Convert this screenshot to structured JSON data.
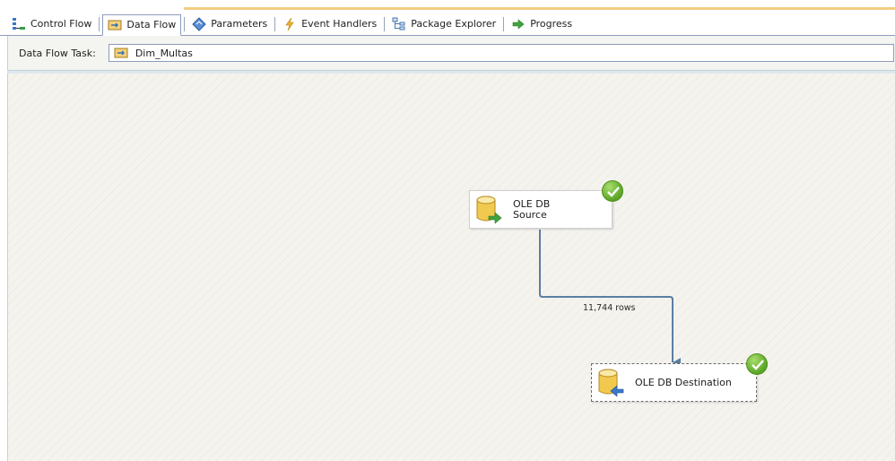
{
  "tabs": [
    {
      "label": "Control Flow",
      "icon": "control-flow-icon"
    },
    {
      "label": "Data Flow",
      "icon": "data-flow-icon",
      "active": true
    },
    {
      "label": "Parameters",
      "icon": "parameters-icon"
    },
    {
      "label": "Event Handlers",
      "icon": "event-handlers-icon"
    },
    {
      "label": "Package Explorer",
      "icon": "package-explorer-icon"
    },
    {
      "label": "Progress",
      "icon": "progress-icon"
    }
  ],
  "task_selector": {
    "label": "Data Flow Task:",
    "value": "Dim_Multas"
  },
  "components": {
    "source": {
      "line1": "OLE DB",
      "line2": "Source",
      "status": "success"
    },
    "destination": {
      "label": "OLE DB Destination",
      "status": "success"
    }
  },
  "path": {
    "label": "11,744 rows"
  },
  "colors": {
    "accent": "#f5cc84",
    "path_line": "#5a7ea3",
    "success": "#5aa526",
    "surface": "#f5f3ed"
  }
}
